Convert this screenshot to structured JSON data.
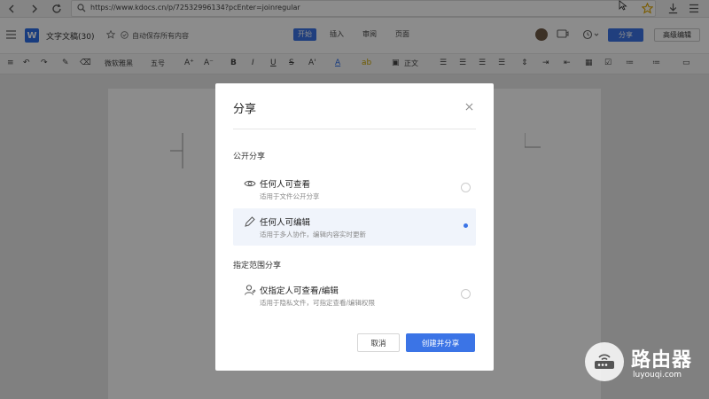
{
  "browser": {
    "url": "https://www.kdocs.cn/p/72532996134?pcEnter=joinregular"
  },
  "app": {
    "logo_letter": "W",
    "doc_title": "文字文稿(30)",
    "autosave": "自动保存所有内容",
    "menu_tabs": [
      "开始",
      "插入",
      "审阅",
      "页面"
    ],
    "share_label": "分享",
    "advanced_edit_label": "高级编辑",
    "accent_color": "#3b74e6"
  },
  "toolbar": {
    "font_name": "微软雅黑",
    "font_size": "五号",
    "paragraph_style": "正文"
  },
  "dialog": {
    "title": "分享",
    "public_section": "公开分享",
    "options": [
      {
        "title": "任何人可查看",
        "desc": "适用于文件公开分享",
        "icon": "eye-icon",
        "selected": false
      },
      {
        "title": "任何人可编辑",
        "desc": "适用于多人协作，编辑内容实时更新",
        "icon": "pencil-icon",
        "selected": true
      }
    ],
    "scoped_section": "指定范围分享",
    "scoped_option": {
      "title": "仅指定人可查看/编辑",
      "desc": "适用于隐私文件，可指定查看/编辑权限",
      "icon": "user-icon",
      "selected": false
    },
    "cancel_label": "取消",
    "create_label": "创建并分享"
  },
  "watermark": {
    "title": "路由器",
    "url": "luyouqi.com"
  }
}
